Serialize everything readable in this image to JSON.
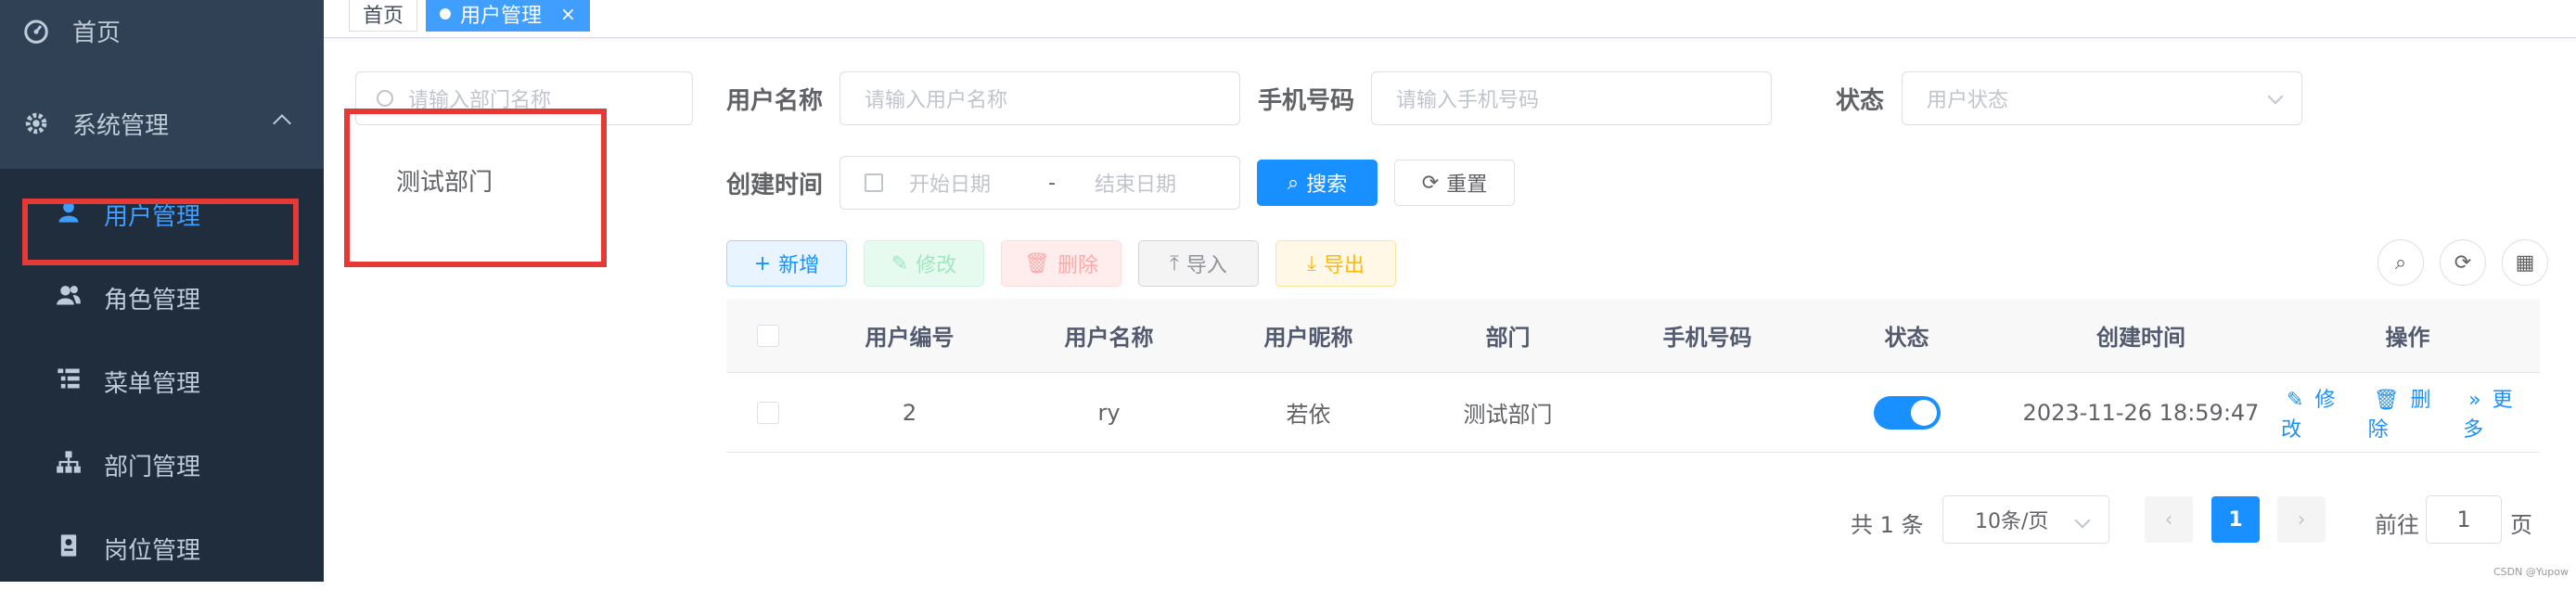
{
  "sidebar": {
    "home": "首页",
    "system": "系统管理",
    "items": [
      {
        "label": "用户管理",
        "icon": "user-icon",
        "active": true
      },
      {
        "label": "角色管理",
        "icon": "peoples-icon"
      },
      {
        "label": "菜单管理",
        "icon": "tree-table-icon"
      },
      {
        "label": "部门管理",
        "icon": "tree-icon"
      },
      {
        "label": "岗位管理",
        "icon": "post-icon"
      }
    ]
  },
  "tags": {
    "home": "首页",
    "active": "用户管理",
    "close": "×"
  },
  "dept": {
    "search_placeholder": "请输入部门名称",
    "node": "测试部门"
  },
  "form": {
    "username_label": "用户名称",
    "username_placeholder": "请输入用户名称",
    "phone_label": "手机号码",
    "phone_placeholder": "请输入手机号码",
    "status_label": "状态",
    "status_placeholder": "用户状态",
    "created_label": "创建时间",
    "start_placeholder": "开始日期",
    "date_sep": "-",
    "end_placeholder": "结束日期",
    "search_btn": "搜索",
    "reset_btn": "重置"
  },
  "toolbar": {
    "add": "新增",
    "edit": "修改",
    "delete": "删除",
    "import": "导入",
    "export": "导出"
  },
  "table": {
    "columns": [
      "用户编号",
      "用户名称",
      "用户昵称",
      "部门",
      "手机号码",
      "状态",
      "创建时间",
      "操作"
    ],
    "rows": [
      {
        "id": "2",
        "username": "ry",
        "nickname": "若依",
        "dept": "测试部门",
        "phone": "",
        "status_on": true,
        "created": "2023-11-26 18:59:47",
        "ops": {
          "edit": "修改",
          "delete": "删除",
          "more": "更多"
        }
      }
    ]
  },
  "pagination": {
    "total": "共 1 条",
    "page_size": "10条/页",
    "current": "1",
    "goto_label": "前往",
    "goto_value": "1",
    "page_unit": "页"
  },
  "watermark": "CSDN @Yupow",
  "colors": {
    "primary": "#1890ff",
    "sidebar": "#304156",
    "highlight": "#e53935"
  }
}
